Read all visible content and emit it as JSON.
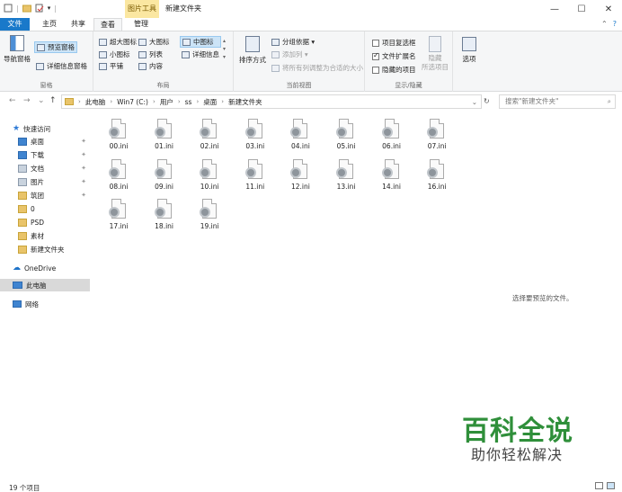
{
  "window": {
    "context_tab": "图片工具",
    "title": "新建文件夹",
    "minimize": "—",
    "maximize": "☐",
    "close": "✕"
  },
  "tabs": {
    "file": "文件",
    "home": "主页",
    "share": "共享",
    "view": "查看",
    "manage": "管理",
    "collapse_icon": "chevron-up-icon",
    "help_icon": "help-icon"
  },
  "ribbon": {
    "panes": {
      "title": "窗格",
      "nav_pane": "导航窗格",
      "preview_pane": "预览窗格",
      "details_pane": "详细信息窗格"
    },
    "layout": {
      "title": "布局",
      "extra_large": "超大图标",
      "large": "大图标",
      "medium": "中图标",
      "small": "小图标",
      "list": "列表",
      "details": "详细信息",
      "tiles": "平铺",
      "content": "内容"
    },
    "current_view": {
      "title": "当前视图",
      "sort": "排序方式",
      "group_by": "分组依据 ▾",
      "add_columns": "添加列 ▾",
      "fit_columns": "将所有列调整为合适的大小"
    },
    "show_hide": {
      "title": "显示/隐藏",
      "item_checkboxes": "项目复选框",
      "item_checkboxes_checked": false,
      "file_extensions": "文件扩展名",
      "file_extensions_checked": true,
      "hidden_items": "隐藏的项目",
      "hidden_items_checked": false,
      "hide": "隐藏",
      "hide_selected": "所选项目"
    },
    "options": "选项"
  },
  "address": {
    "back": "←",
    "forward": "→",
    "recent": "⌄",
    "up": "↑",
    "path": [
      "此电脑",
      "Win7 (C:)",
      "用户",
      "ss",
      "桌面",
      "新建文件夹"
    ],
    "search_placeholder": "搜索\"新建文件夹\""
  },
  "nav": {
    "quick_access": "快速访问",
    "items": [
      {
        "label": "桌面",
        "pinned": true
      },
      {
        "label": "下载",
        "pinned": true
      },
      {
        "label": "文档",
        "pinned": true
      },
      {
        "label": "图片",
        "pinned": true
      },
      {
        "label": "筑团",
        "pinned": true
      },
      {
        "label": "0",
        "pinned": false
      },
      {
        "label": "PSD",
        "pinned": false
      },
      {
        "label": "素材",
        "pinned": false
      },
      {
        "label": "新建文件夹",
        "pinned": false
      }
    ],
    "onedrive": "OneDrive",
    "this_pc": "此电脑",
    "network": "网络"
  },
  "files": [
    "00.ini",
    "01.ini",
    "02.ini",
    "03.ini",
    "04.ini",
    "05.ini",
    "06.ini",
    "07.ini",
    "08.ini",
    "09.ini",
    "10.ini",
    "11.ini",
    "12.ini",
    "13.ini",
    "14.ini",
    "16.ini",
    "17.ini",
    "18.ini",
    "19.ini"
  ],
  "preview_message": "选择要预览的文件。",
  "watermark": {
    "line1": "百科全说",
    "line2": "助你轻松解决"
  },
  "status": {
    "count": "19 个项目"
  }
}
